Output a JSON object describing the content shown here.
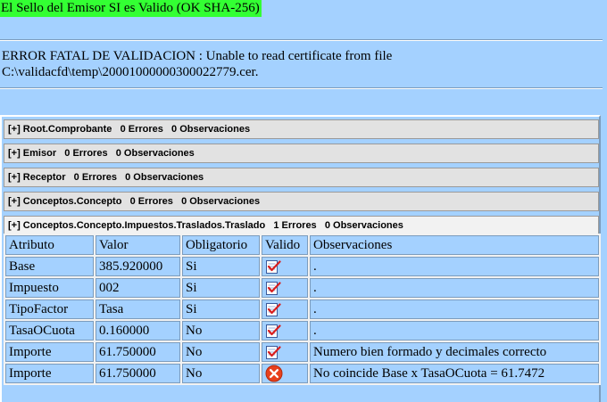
{
  "banner": "El Sello del Emisor SI es Valido (OK SHA-256)",
  "error": {
    "line1": "ERROR FATAL DE VALIDACION : Unable to read certificate from file",
    "line2": "C:\\validacfd\\temp\\20001000000300022779.cer."
  },
  "sections": [
    {
      "label": "[+] Root.Comprobante   0 Errores   0 Observaciones"
    },
    {
      "label": "[+] Emisor   0 Errores   0 Observaciones"
    },
    {
      "label": "[+] Receptor   0 Errores   0 Observaciones"
    },
    {
      "label": "[+] Conceptos.Concepto   0 Errores   0 Observaciones"
    },
    {
      "label": "[+] Conceptos.Concepto.Impuestos.Traslados.Traslado   1 Errores   0 Observaciones"
    }
  ],
  "table": {
    "headers": [
      "Atributo",
      "Valor",
      "Obligatorio",
      "Valido",
      "Observaciones"
    ],
    "rows": [
      {
        "atributo": "Base",
        "valor": "385.920000",
        "obligatorio": "Si",
        "valido": "ok-icon",
        "observaciones": "."
      },
      {
        "atributo": "Impuesto",
        "valor": "002",
        "obligatorio": "Si",
        "valido": "ok-icon",
        "observaciones": "."
      },
      {
        "atributo": "TipoFactor",
        "valor": "Tasa",
        "obligatorio": "Si",
        "valido": "ok-icon",
        "observaciones": "."
      },
      {
        "atributo": "TasaOCuota",
        "valor": "0.160000",
        "obligatorio": "No",
        "valido": "ok-icon",
        "observaciones": "."
      },
      {
        "atributo": "Importe",
        "valor": "61.750000",
        "obligatorio": "No",
        "valido": "ok-icon",
        "observaciones": "Numero bien formado y decimales correcto"
      },
      {
        "atributo": "Importe",
        "valor": "61.750000",
        "obligatorio": "No",
        "valido": "error-icon",
        "observaciones": "No coincide Base x TasaOCuota = 61.7472"
      }
    ]
  },
  "colors": {
    "background": "#a4d1ff",
    "banner": "#33ff33",
    "section": "#e2e2e2",
    "error_icon": "#e8401c"
  }
}
